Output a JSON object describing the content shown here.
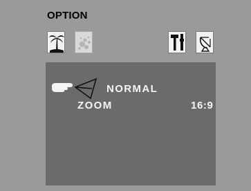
{
  "menu": {
    "title": "OPTION",
    "tabs": [
      {
        "icon": "palm-tree-icon",
        "active": true
      },
      {
        "icon": "splatter-icon",
        "active": false
      },
      {
        "icon": "tools-icon",
        "active": true
      },
      {
        "icon": "satellite-dish-icon",
        "active": true
      }
    ]
  },
  "panel": {
    "mode_value": "NORMAL",
    "zoom_label": "ZOOM",
    "zoom_value": "16:9"
  }
}
